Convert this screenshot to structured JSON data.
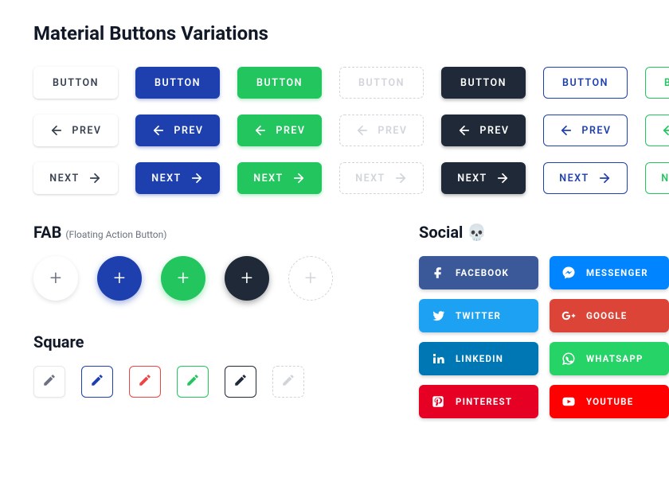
{
  "title": "Material Buttons Variations",
  "labels": {
    "button": "BUTTON",
    "prev": "PREV",
    "next": "NEXT"
  },
  "sections": {
    "fab_title": "FAB",
    "fab_sub": "(Floating Action Button)",
    "square_title": "Square",
    "social_title": "Social 💀"
  },
  "fab_glyph": "+",
  "social": {
    "facebook": "FACEBOOK",
    "messenger": "MESSENGER",
    "twitter": "TWITTER",
    "google": "GOOGLE",
    "linkedin": "LINKEDIN",
    "whatsapp": "WHATSAPP",
    "pinterest": "PINTEREST",
    "youtube": "YOUTUBE"
  }
}
